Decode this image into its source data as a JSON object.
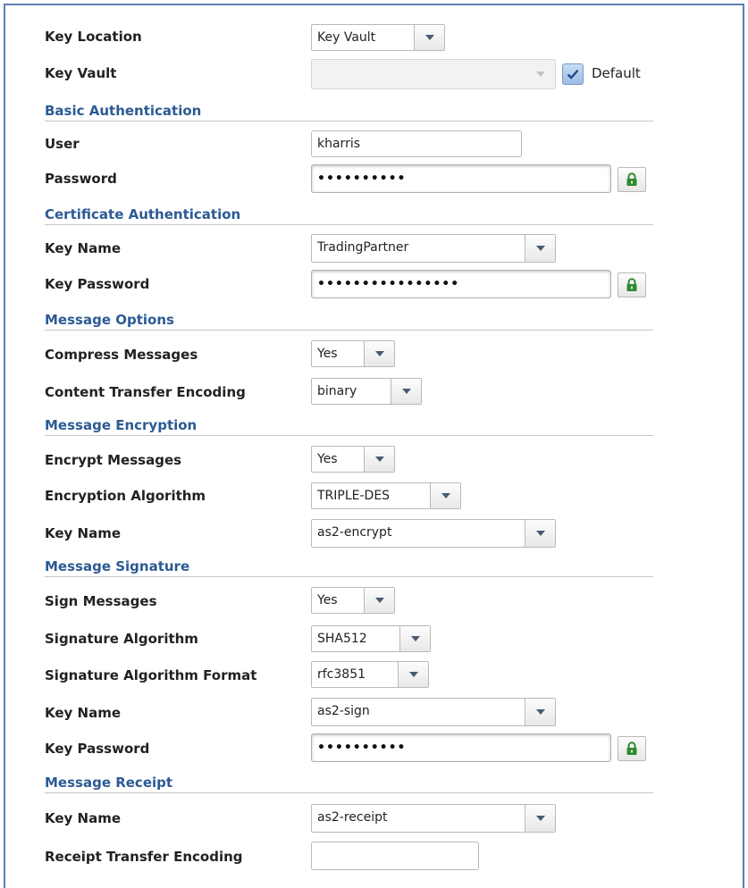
{
  "key_location": {
    "label": "Key Location",
    "value": "Key Vault"
  },
  "key_vault": {
    "label": "Key Vault",
    "value": "",
    "default_label": "Default",
    "default_checked": true
  },
  "basic_auth": {
    "title": "Basic Authentication",
    "user_label": "User",
    "user_value": "kharris",
    "password_label": "Password",
    "password_mask": "••••••••••"
  },
  "cert_auth": {
    "title": "Certificate Authentication",
    "key_name_label": "Key Name",
    "key_name_value": "TradingPartner",
    "key_password_label": "Key Password",
    "key_password_mask": "••••••••••••••••"
  },
  "message_options": {
    "title": "Message Options",
    "compress_label": "Compress Messages",
    "compress_value": "Yes",
    "cte_label": "Content Transfer Encoding",
    "cte_value": "binary"
  },
  "message_encryption": {
    "title": "Message Encryption",
    "encrypt_label": "Encrypt Messages",
    "encrypt_value": "Yes",
    "algorithm_label": "Encryption Algorithm",
    "algorithm_value": "TRIPLE-DES",
    "key_name_label": "Key Name",
    "key_name_value": "as2-encrypt"
  },
  "message_signature": {
    "title": "Message Signature",
    "sign_label": "Sign Messages",
    "sign_value": "Yes",
    "algorithm_label": "Signature Algorithm",
    "algorithm_value": "SHA512",
    "format_label": "Signature Algorithm Format",
    "format_value": "rfc3851",
    "key_name_label": "Key Name",
    "key_name_value": "as2-sign",
    "key_password_label": "Key Password",
    "key_password_mask": "••••••••••"
  },
  "message_receipt": {
    "title": "Message Receipt",
    "key_name_label": "Key Name",
    "key_name_value": "as2-receipt",
    "rte_label": "Receipt Transfer Encoding",
    "rte_value": ""
  },
  "icons": {
    "lock": "lock-icon",
    "dropdown": "chevron-down-icon",
    "check": "checkmark-icon"
  },
  "colors": {
    "section_title": "#2c5a94",
    "lock_green": "#2e8b2e",
    "frame": "#5b7fb3"
  }
}
